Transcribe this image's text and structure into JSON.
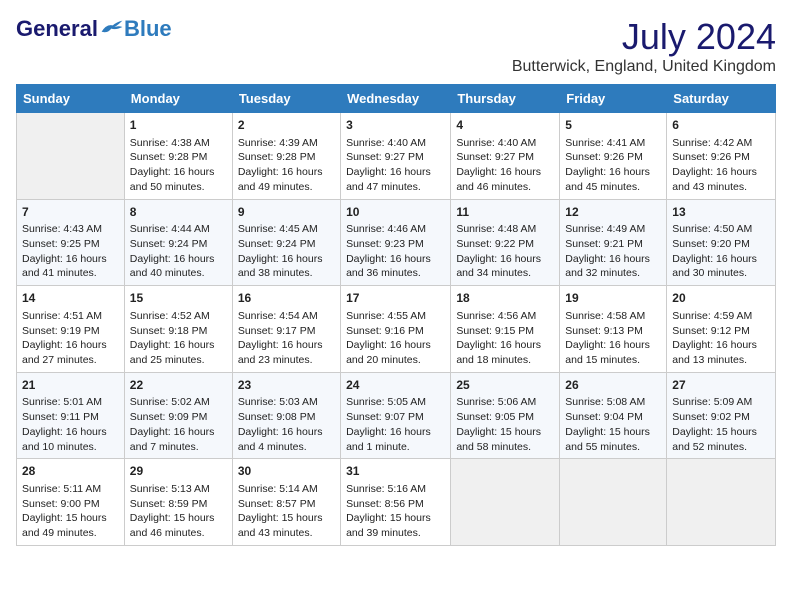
{
  "header": {
    "logo_general": "General",
    "logo_blue": "Blue",
    "month_year": "July 2024",
    "location": "Butterwick, England, United Kingdom"
  },
  "days_of_week": [
    "Sunday",
    "Monday",
    "Tuesday",
    "Wednesday",
    "Thursday",
    "Friday",
    "Saturday"
  ],
  "weeks": [
    [
      {
        "day": "",
        "sunrise": "",
        "sunset": "",
        "daylight": ""
      },
      {
        "day": "1",
        "sunrise": "4:38 AM",
        "sunset": "9:28 PM",
        "daylight": "16 hours and 50 minutes."
      },
      {
        "day": "2",
        "sunrise": "4:39 AM",
        "sunset": "9:28 PM",
        "daylight": "16 hours and 49 minutes."
      },
      {
        "day": "3",
        "sunrise": "4:40 AM",
        "sunset": "9:27 PM",
        "daylight": "16 hours and 47 minutes."
      },
      {
        "day": "4",
        "sunrise": "4:40 AM",
        "sunset": "9:27 PM",
        "daylight": "16 hours and 46 minutes."
      },
      {
        "day": "5",
        "sunrise": "4:41 AM",
        "sunset": "9:26 PM",
        "daylight": "16 hours and 45 minutes."
      },
      {
        "day": "6",
        "sunrise": "4:42 AM",
        "sunset": "9:26 PM",
        "daylight": "16 hours and 43 minutes."
      }
    ],
    [
      {
        "day": "7",
        "sunrise": "4:43 AM",
        "sunset": "9:25 PM",
        "daylight": "16 hours and 41 minutes."
      },
      {
        "day": "8",
        "sunrise": "4:44 AM",
        "sunset": "9:24 PM",
        "daylight": "16 hours and 40 minutes."
      },
      {
        "day": "9",
        "sunrise": "4:45 AM",
        "sunset": "9:24 PM",
        "daylight": "16 hours and 38 minutes."
      },
      {
        "day": "10",
        "sunrise": "4:46 AM",
        "sunset": "9:23 PM",
        "daylight": "16 hours and 36 minutes."
      },
      {
        "day": "11",
        "sunrise": "4:48 AM",
        "sunset": "9:22 PM",
        "daylight": "16 hours and 34 minutes."
      },
      {
        "day": "12",
        "sunrise": "4:49 AM",
        "sunset": "9:21 PM",
        "daylight": "16 hours and 32 minutes."
      },
      {
        "day": "13",
        "sunrise": "4:50 AM",
        "sunset": "9:20 PM",
        "daylight": "16 hours and 30 minutes."
      }
    ],
    [
      {
        "day": "14",
        "sunrise": "4:51 AM",
        "sunset": "9:19 PM",
        "daylight": "16 hours and 27 minutes."
      },
      {
        "day": "15",
        "sunrise": "4:52 AM",
        "sunset": "9:18 PM",
        "daylight": "16 hours and 25 minutes."
      },
      {
        "day": "16",
        "sunrise": "4:54 AM",
        "sunset": "9:17 PM",
        "daylight": "16 hours and 23 minutes."
      },
      {
        "day": "17",
        "sunrise": "4:55 AM",
        "sunset": "9:16 PM",
        "daylight": "16 hours and 20 minutes."
      },
      {
        "day": "18",
        "sunrise": "4:56 AM",
        "sunset": "9:15 PM",
        "daylight": "16 hours and 18 minutes."
      },
      {
        "day": "19",
        "sunrise": "4:58 AM",
        "sunset": "9:13 PM",
        "daylight": "16 hours and 15 minutes."
      },
      {
        "day": "20",
        "sunrise": "4:59 AM",
        "sunset": "9:12 PM",
        "daylight": "16 hours and 13 minutes."
      }
    ],
    [
      {
        "day": "21",
        "sunrise": "5:01 AM",
        "sunset": "9:11 PM",
        "daylight": "16 hours and 10 minutes."
      },
      {
        "day": "22",
        "sunrise": "5:02 AM",
        "sunset": "9:09 PM",
        "daylight": "16 hours and 7 minutes."
      },
      {
        "day": "23",
        "sunrise": "5:03 AM",
        "sunset": "9:08 PM",
        "daylight": "16 hours and 4 minutes."
      },
      {
        "day": "24",
        "sunrise": "5:05 AM",
        "sunset": "9:07 PM",
        "daylight": "16 hours and 1 minute."
      },
      {
        "day": "25",
        "sunrise": "5:06 AM",
        "sunset": "9:05 PM",
        "daylight": "15 hours and 58 minutes."
      },
      {
        "day": "26",
        "sunrise": "5:08 AM",
        "sunset": "9:04 PM",
        "daylight": "15 hours and 55 minutes."
      },
      {
        "day": "27",
        "sunrise": "5:09 AM",
        "sunset": "9:02 PM",
        "daylight": "15 hours and 52 minutes."
      }
    ],
    [
      {
        "day": "28",
        "sunrise": "5:11 AM",
        "sunset": "9:00 PM",
        "daylight": "15 hours and 49 minutes."
      },
      {
        "day": "29",
        "sunrise": "5:13 AM",
        "sunset": "8:59 PM",
        "daylight": "15 hours and 46 minutes."
      },
      {
        "day": "30",
        "sunrise": "5:14 AM",
        "sunset": "8:57 PM",
        "daylight": "15 hours and 43 minutes."
      },
      {
        "day": "31",
        "sunrise": "5:16 AM",
        "sunset": "8:56 PM",
        "daylight": "15 hours and 39 minutes."
      },
      {
        "day": "",
        "sunrise": "",
        "sunset": "",
        "daylight": ""
      },
      {
        "day": "",
        "sunrise": "",
        "sunset": "",
        "daylight": ""
      },
      {
        "day": "",
        "sunrise": "",
        "sunset": "",
        "daylight": ""
      }
    ]
  ]
}
